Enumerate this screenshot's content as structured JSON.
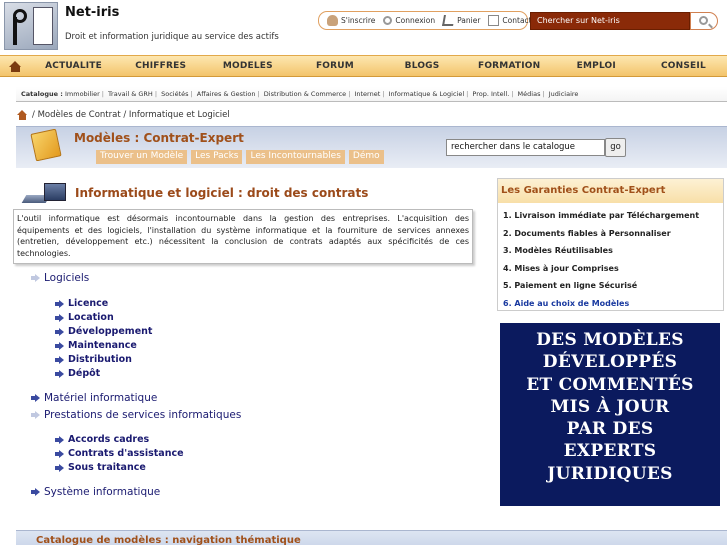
{
  "header": {
    "site_title": "Net-iris",
    "site_subtitle": "Droit et information juridique au service des actifs",
    "links": {
      "register": "S'inscrire",
      "login": "Connexion",
      "cart": "Panier",
      "contact": "Contact"
    },
    "search_placeholder": "Chercher sur Net-iris"
  },
  "nav": {
    "items": [
      "ACTUALITE",
      "CHIFFRES",
      "MODELES",
      "FORUM",
      "BLOGS",
      "FORMATION",
      "EMPLOI",
      "CONSEIL"
    ]
  },
  "catalogue": {
    "label": "Catalogue :",
    "items": [
      "Immobilier",
      "Travail & GRH",
      "Sociétés",
      "Affaires & Gestion",
      "Distribution & Commerce",
      "Internet",
      "Informatique & Logiciel",
      "Prop. Intell.",
      "Médias",
      "Judiciaire"
    ]
  },
  "breadcrumb": {
    "text": "/ Modèles de Contrat / Informatique et Logiciel"
  },
  "banner": {
    "title": "Modèles : Contrat-Expert",
    "tabs": [
      "Trouver un Modèle",
      "Les Packs",
      "Les Incontournables",
      "Démo"
    ],
    "search_value": "rechercher dans le catalogue",
    "go_label": "go"
  },
  "main": {
    "title": "Informatique et logiciel : droit des contrats",
    "intro": "L'outil informatique est désormais incontournable dans la gestion des entreprises. L'acquisition des équipements et des logiciels, l'installation du système informatique et la fourniture de services annexes (entretien, développement etc.) nécessitent la conclusion de contrats adaptés aux spécificités de ces technologies.",
    "categories": {
      "logiciels": "Logiciels",
      "licence": "Licence",
      "location": "Location",
      "developpement": "Développement",
      "maintenance": "Maintenance",
      "distribution": "Distribution",
      "depot": "Dépôt",
      "materiel": "Matériel informatique",
      "prestations": "Prestations de services informatiques",
      "accords": "Accords cadres",
      "assistance": "Contrats d'assistance",
      "soustraitance": "Sous traitance",
      "systeme": "Système informatique"
    }
  },
  "guarantees": {
    "title": "Les Garanties Contrat-Expert",
    "items": [
      "1.  Livraison immédiate par Téléchargement",
      "2.  Documents fiables à Personnaliser",
      "3.  Modèles Réutilisables",
      "4.  Mises à jour Comprises",
      "5.  Paiement en ligne Sécurisé",
      "6.  Aide au choix de Modèles"
    ]
  },
  "promo": {
    "lines": [
      "DES MODÈLES",
      "DÉVELOPPÉS",
      "ET COMMENTÉS",
      "MIS À JOUR",
      "PAR DES",
      "EXPERTS",
      "JURIDIQUES"
    ]
  },
  "bottom": {
    "title": "Catalogue de modèles : navigation thématique"
  },
  "colors": {
    "accent": "#a0501a",
    "nav_bg": "#f3c46b",
    "link": "#1a1a70",
    "promo_bg": "#0b1a5e"
  }
}
